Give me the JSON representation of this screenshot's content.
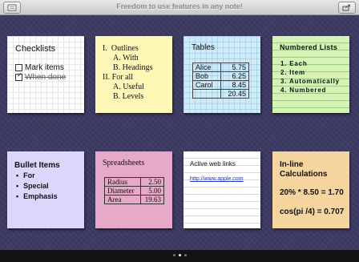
{
  "header": {
    "title": "Freedom to use features in any note!"
  },
  "notes": {
    "checklists": {
      "title": "Checklists",
      "items": [
        {
          "label": "Mark items",
          "checked": false
        },
        {
          "label": "When done",
          "checked": true
        }
      ]
    },
    "outlines": {
      "lines": [
        {
          "marker": "I.",
          "text": "Outlines"
        },
        {
          "marker": "A.",
          "text": "With"
        },
        {
          "marker": "B.",
          "text": "Headings"
        },
        {
          "marker": "II.",
          "text": "For all"
        },
        {
          "marker": "A.",
          "text": "Useful"
        },
        {
          "marker": "B.",
          "text": "Levels"
        }
      ]
    },
    "tables": {
      "title": "Tables",
      "rows": [
        [
          "Alice",
          "5.75"
        ],
        [
          "Bob",
          "6.25"
        ],
        [
          "Carol",
          "8.45"
        ],
        [
          "",
          "20.45"
        ]
      ]
    },
    "numbered": {
      "title": "Numbered Lists",
      "items": [
        "1. Each",
        "2. Item",
        "3. Automatically",
        "4. Numbered"
      ]
    },
    "bullets": {
      "title": "Bullet Items",
      "items": [
        "For",
        "Special",
        "Emphasis"
      ]
    },
    "spreadsheets": {
      "title": "Spreadsheets",
      "rows": [
        [
          "Radius",
          "2.50"
        ],
        [
          "Diameter",
          "5.00"
        ],
        [
          "Area",
          "19.63"
        ]
      ]
    },
    "weblinks": {
      "title": "Active web links",
      "link": "http://www.apple.com"
    },
    "calculations": {
      "title_line1": "In-line",
      "title_line2": "Calculations",
      "expr1": "20% * 8.50 = 1.70",
      "expr2": "cos(pi /4) = 0.707"
    }
  },
  "page_indicator": {
    "pages": 3,
    "current": 2
  },
  "colors": {
    "background": "#3d3a63",
    "yellow": "#fdf8b6",
    "blue": "#cdeaf9",
    "green": "#d4f3b4",
    "purple": "#ddd5fb",
    "pink": "#e6aac8",
    "orange": "#f5d49e"
  },
  "icons": {
    "left_button": "notepad-icon",
    "right_button": "share-icon"
  }
}
